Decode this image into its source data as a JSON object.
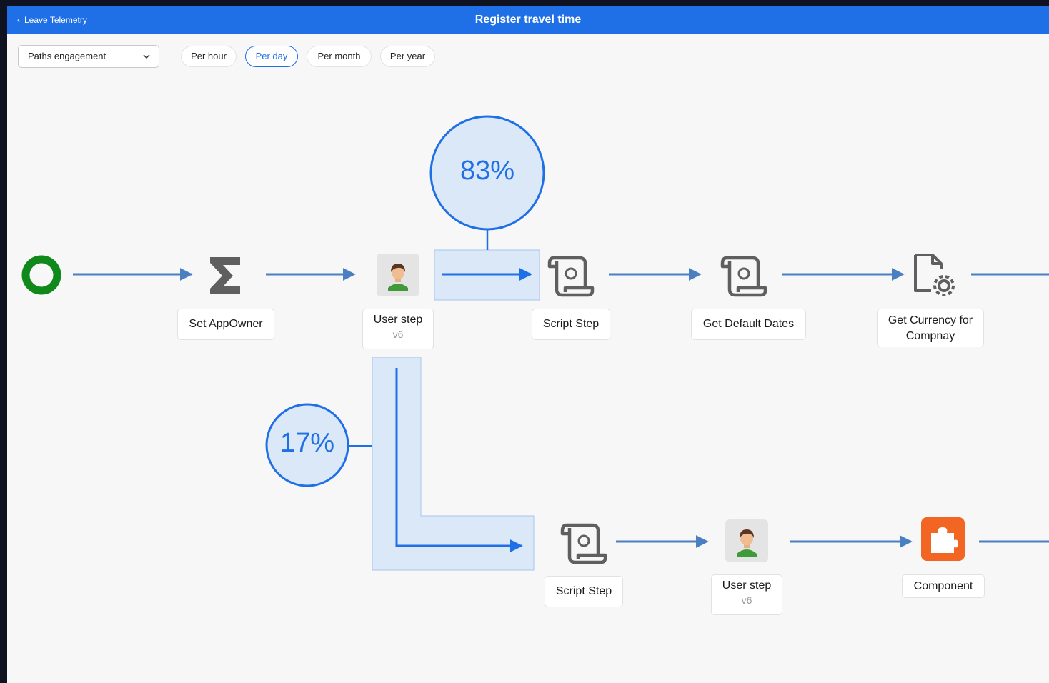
{
  "header": {
    "back_label": "Leave Telemetry",
    "title": "Register travel time"
  },
  "toolbar": {
    "select_value": "Paths engagement",
    "periods": [
      "Per hour",
      "Per day",
      "Per month",
      "Per year"
    ],
    "active_period": "Per day"
  },
  "flow": {
    "top_percent": "83%",
    "bottom_percent": "17%",
    "top_row": [
      {
        "label": "Set AppOwner",
        "icon": "sigma-icon"
      },
      {
        "label": "User step",
        "sub": "v6",
        "icon": "user-avatar-icon"
      },
      {
        "label": "Script Step",
        "icon": "script-scroll-icon"
      },
      {
        "label": "Get Default Dates",
        "icon": "script-scroll-icon"
      },
      {
        "label": "Get Currency for Compnay",
        "icon": "document-gear-icon"
      }
    ],
    "bottom_row": [
      {
        "label": "Script Step",
        "icon": "script-scroll-icon"
      },
      {
        "label": "User step",
        "sub": "v6",
        "icon": "user-avatar-icon"
      },
      {
        "label": "Component",
        "icon": "puzzle-icon"
      }
    ]
  },
  "colors": {
    "accent": "#1f6fe6",
    "titlebar": "#1f6fe6",
    "start_node": "#0f8a1a",
    "connector": "#4a7fc2",
    "highlight_fill": "#dbe8f8",
    "component": "#f26522",
    "icon_gray": "#5f5f5f"
  }
}
